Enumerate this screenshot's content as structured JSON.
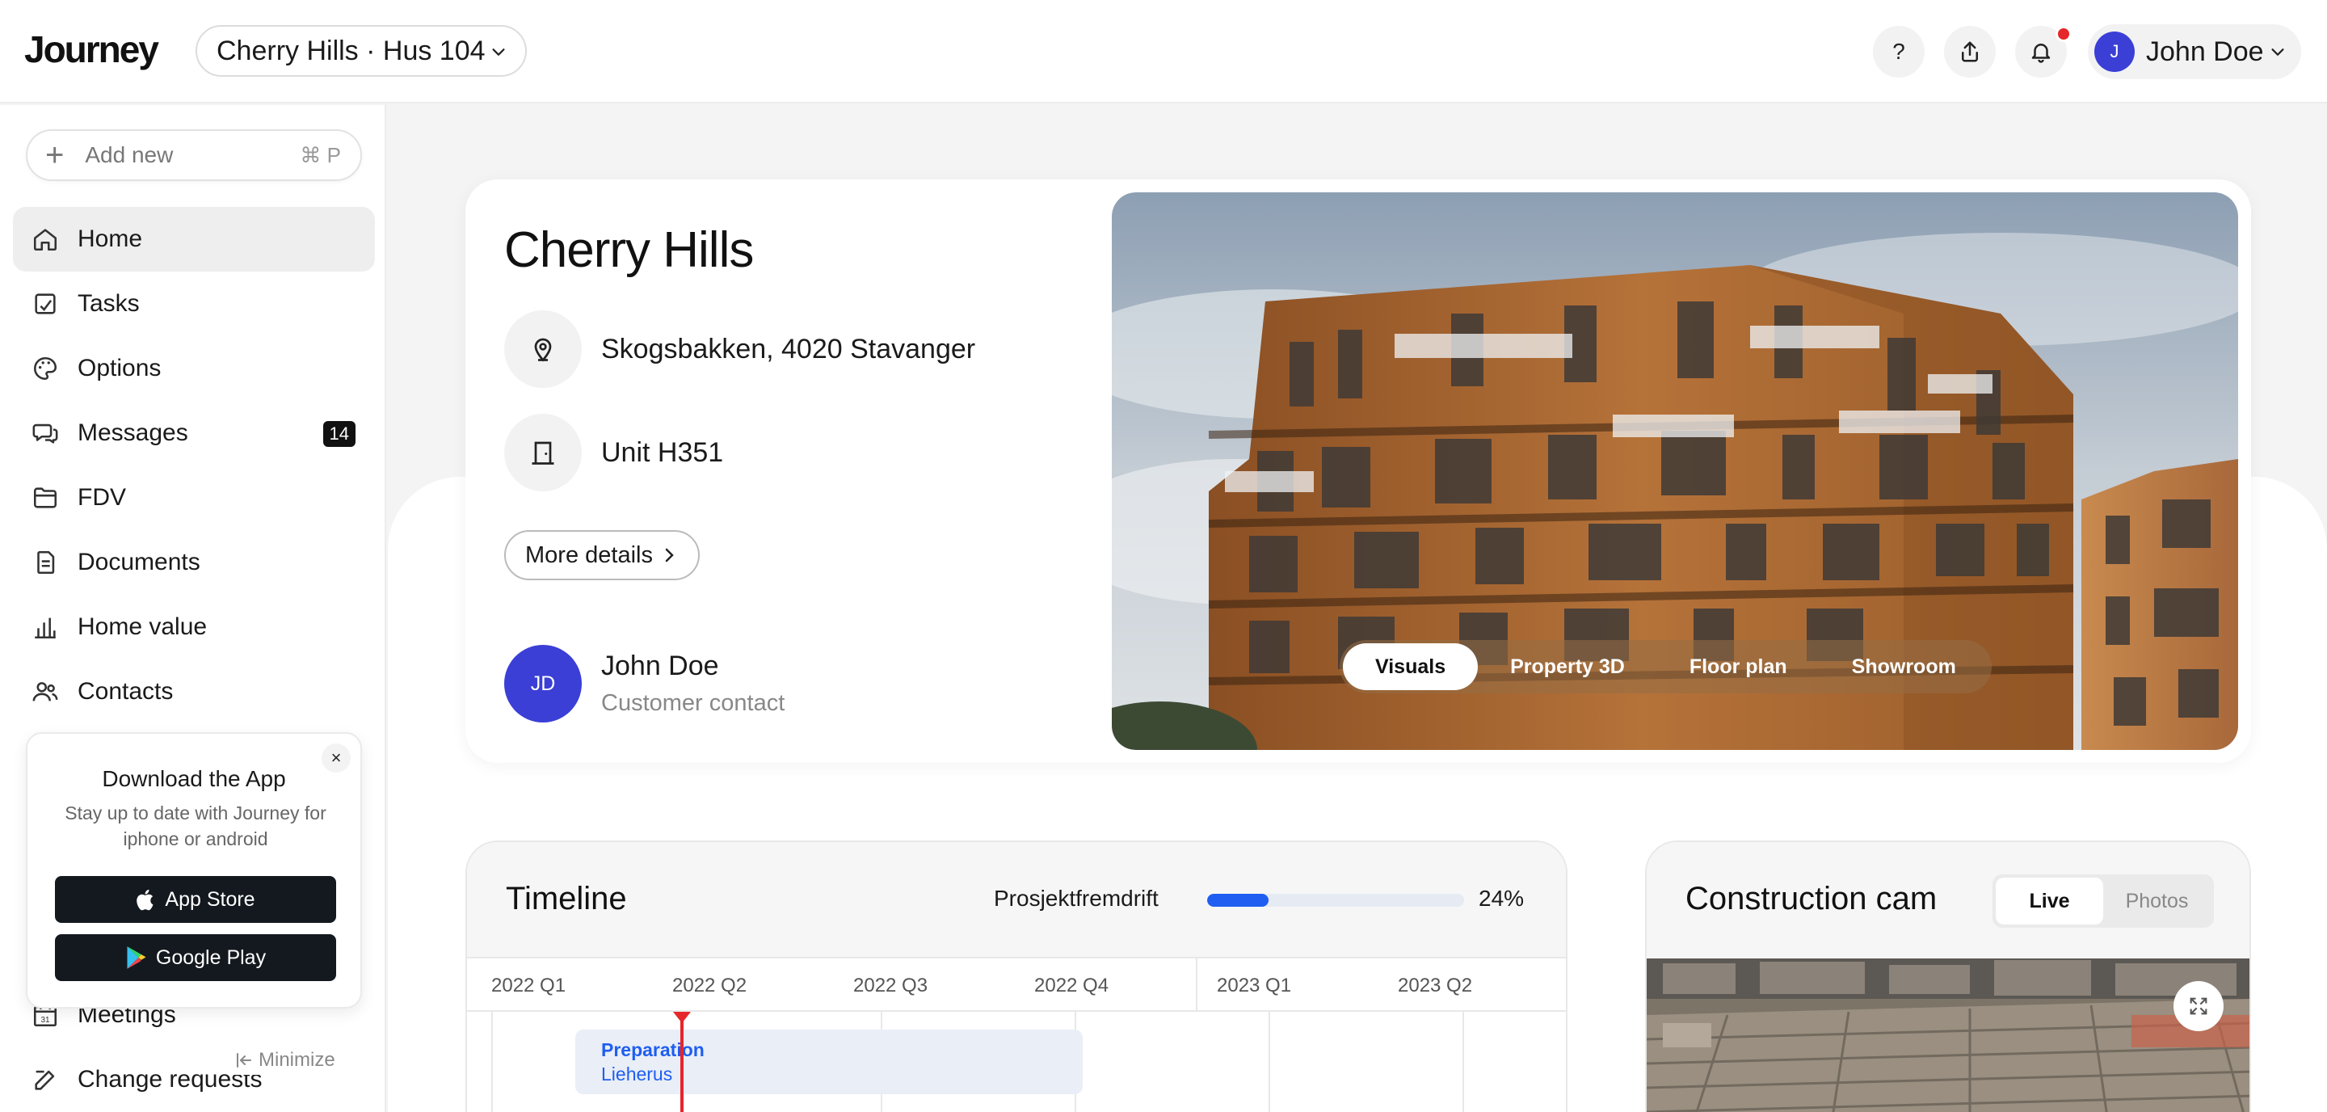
{
  "header": {
    "logo": "Journey",
    "project_selector": "Cherry Hills · Hus 104",
    "help_label": "?",
    "user_initial": "J",
    "user_name": "John Doe"
  },
  "sidebar": {
    "add_new": {
      "label": "Add new",
      "shortcut": "⌘ P"
    },
    "items": [
      {
        "label": "Home",
        "icon": "home-icon",
        "active": true
      },
      {
        "label": "Tasks",
        "icon": "tasks-icon"
      },
      {
        "label": "Options",
        "icon": "palette-icon"
      },
      {
        "label": "Messages",
        "icon": "chat-icon",
        "badge": "14"
      },
      {
        "label": "FDV",
        "icon": "folder-icon"
      },
      {
        "label": "Documents",
        "icon": "document-icon"
      },
      {
        "label": "Home value",
        "icon": "bar-chart-icon"
      },
      {
        "label": "Contacts",
        "icon": "contacts-icon"
      }
    ],
    "app_promo": {
      "title": "Download the App",
      "subtitle": "Stay up to date with Journey for iphone or android",
      "app_store": "App Store",
      "google_play": "Google Play"
    },
    "meetings": {
      "label": "Meetings",
      "calendar_day": "31"
    },
    "change_requests": "Change requests",
    "minimize": "Minimize"
  },
  "hero": {
    "title": "Cherry Hills",
    "address": "Skogsbakken, 4020 Stavanger",
    "unit": "Unit H351",
    "more_details": "More details",
    "contact": {
      "initials": "JD",
      "name": "John Doe",
      "role": "Customer contact"
    },
    "tabs": [
      "Visuals",
      "Property 3D",
      "Floor plan",
      "Showroom"
    ],
    "active_tab": "Visuals"
  },
  "timeline": {
    "title": "Timeline",
    "progress_label": "Prosjektfremdrift",
    "progress_percent": 24,
    "progress_text": "24%",
    "quarters": [
      "2022 Q1",
      "2022 Q2",
      "2022 Q3",
      "2022 Q4",
      "2023 Q1",
      "2023 Q2"
    ],
    "task": {
      "title": "Preparation",
      "subtitle": "Lieherus"
    }
  },
  "construction_cam": {
    "title": "Construction cam",
    "options": [
      "Live",
      "Photos"
    ],
    "active": "Live"
  },
  "colors": {
    "accent_blue": "#1f5ef0",
    "avatar_purple": "#3b3fd6",
    "alert_red": "#e5262b",
    "badge_dark": "#111111"
  }
}
